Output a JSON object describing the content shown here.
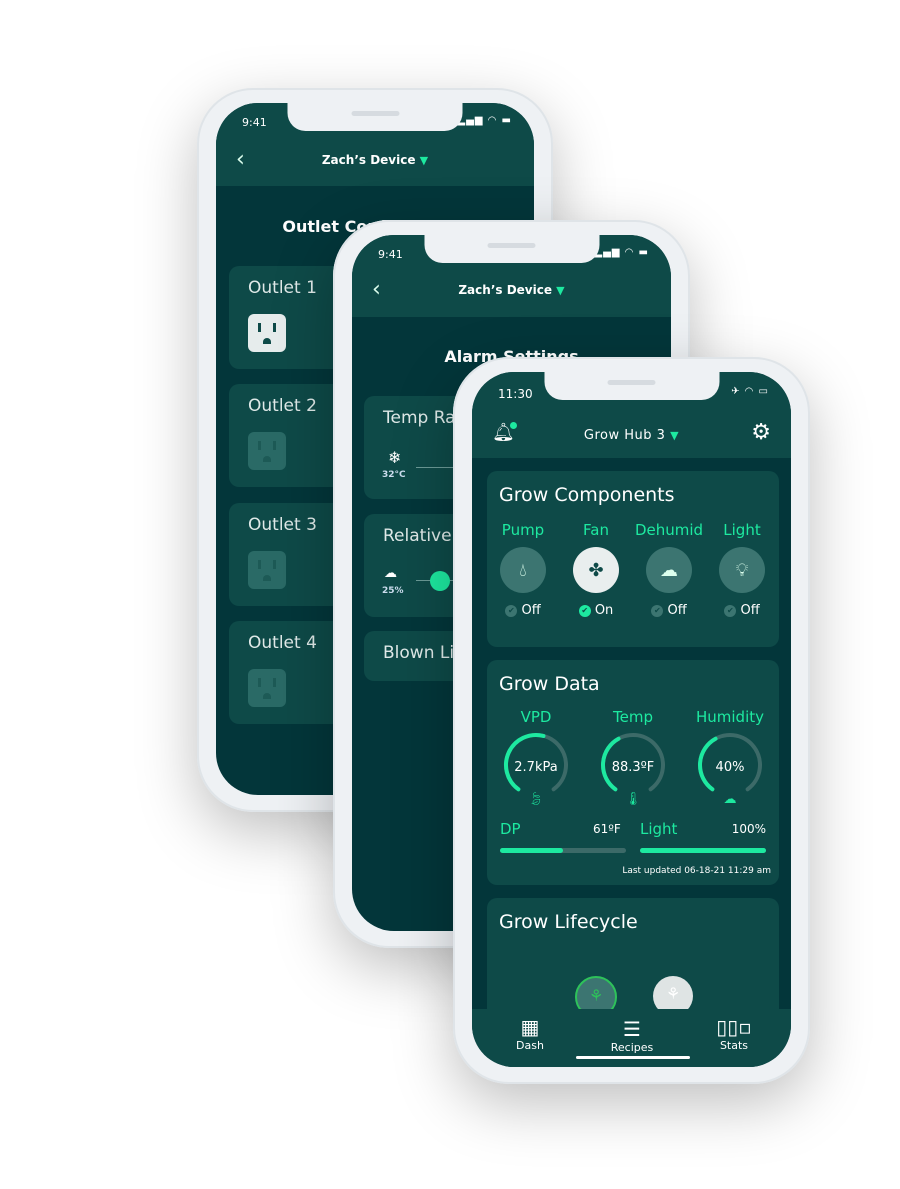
{
  "phone_back": {
    "time": "9:41",
    "device": "Zach’s Device",
    "title": "Outlet Configuration",
    "outlets": [
      {
        "label": "Outlet 1",
        "on": true
      },
      {
        "label": "Outlet 2",
        "on": false
      },
      {
        "label": "Outlet 3",
        "on": false
      },
      {
        "label": "Outlet 4",
        "on": false
      }
    ]
  },
  "phone_mid": {
    "time": "9:41",
    "device": "Zach’s Device",
    "title": "Alarm Settings",
    "cards": [
      {
        "label": "Temp Range",
        "value": "32°C",
        "icon": "snowflake-icon"
      },
      {
        "label": "Relative Humidity",
        "value": "25%",
        "icon": "cloud-icon"
      },
      {
        "label": "Blown Light"
      }
    ]
  },
  "phone_front": {
    "time": "11:30",
    "hub": "Grow Hub 3",
    "components": {
      "title": "Grow Components",
      "items": [
        {
          "name": "Pump",
          "status": "Off",
          "icon": "water-drop-icon",
          "on": false
        },
        {
          "name": "Fan",
          "status": "On",
          "icon": "fan-icon",
          "on": true
        },
        {
          "name": "Dehumid",
          "status": "Off",
          "icon": "cloud-icon",
          "on": false
        },
        {
          "name": "Light",
          "status": "Off",
          "icon": "lightbulb-icon",
          "on": false
        }
      ]
    },
    "data": {
      "title": "Grow Data",
      "gauges": [
        {
          "name": "VPD",
          "value": "2.7kPa",
          "fraction": 0.55,
          "icon": "leaf-icon"
        },
        {
          "name": "Temp",
          "value": "88.3ºF",
          "fraction": 0.4,
          "icon": "thermometer-icon"
        },
        {
          "name": "Humidity",
          "value": "40%",
          "fraction": 0.4,
          "icon": "cloud-icon"
        }
      ],
      "dp_label": "DP",
      "dp_value": "61ºF",
      "dp_fraction": 0.5,
      "light_label": "Light",
      "light_value": "100%",
      "light_fraction": 1.0,
      "updated": "Last updated 06-18-21 11:29 am"
    },
    "lifecycle": {
      "title": "Grow Lifecycle"
    },
    "tabs": [
      {
        "label": "Dash",
        "icon": "grid-icon"
      },
      {
        "label": "Recipes",
        "icon": "document-icon"
      },
      {
        "label": "Stats",
        "icon": "bar-chart-icon"
      }
    ]
  },
  "colors": {
    "accent": "#1de9a0",
    "header": "#0e4a48",
    "background": "#03363a"
  }
}
